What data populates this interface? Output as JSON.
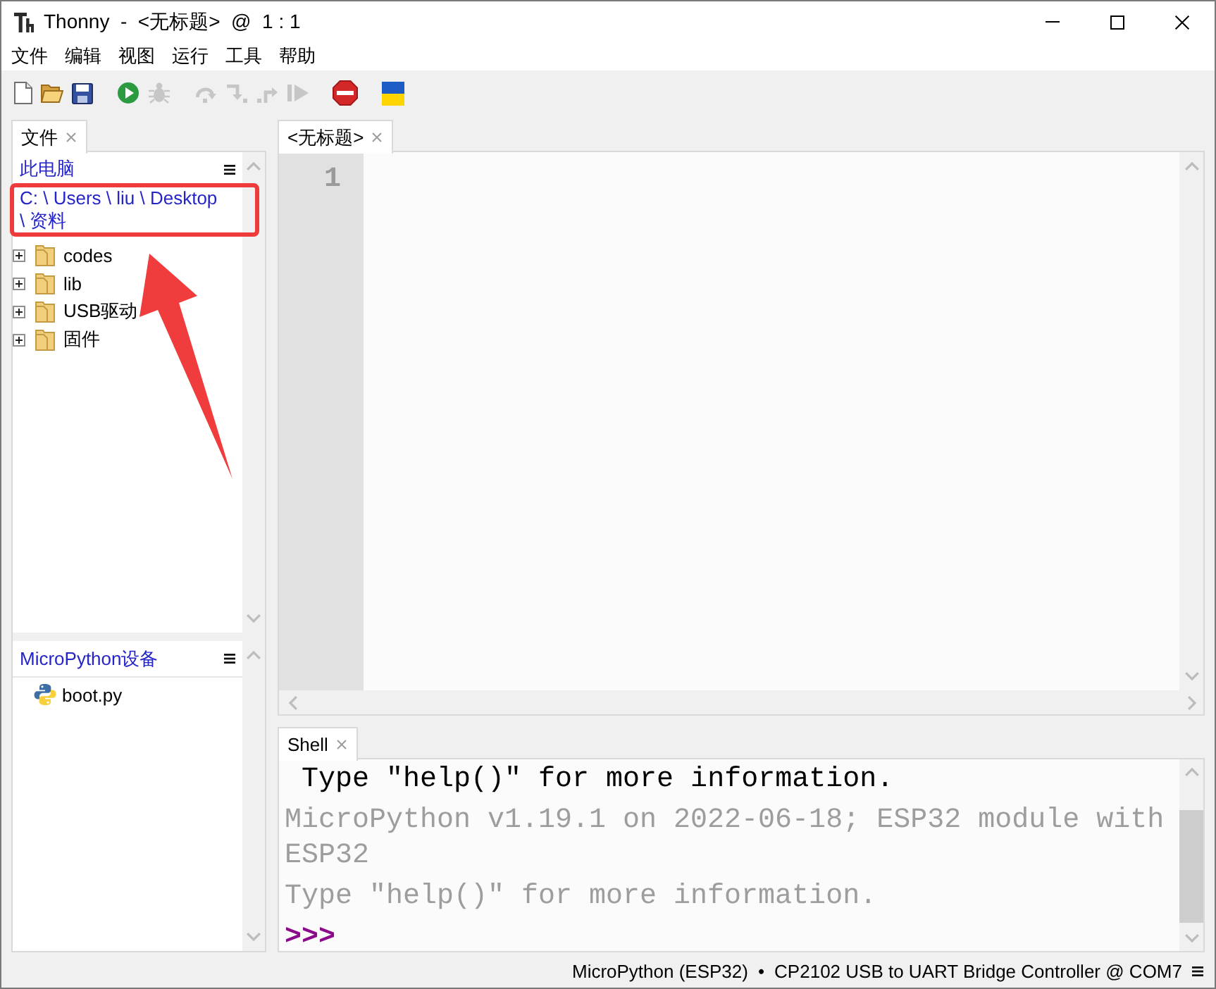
{
  "window": {
    "title": "Thonny  -  <无标题>  @  1 : 1"
  },
  "menu": [
    "文件",
    "编辑",
    "视图",
    "运行",
    "工具",
    "帮助"
  ],
  "toolbar": [
    {
      "kind": "new",
      "disabled": false
    },
    {
      "kind": "open",
      "disabled": false
    },
    {
      "kind": "save",
      "disabled": false
    },
    {
      "kind": "run",
      "disabled": false
    },
    {
      "kind": "debug",
      "disabled": true
    },
    {
      "kind": "step-over",
      "disabled": true
    },
    {
      "kind": "step-into",
      "disabled": true
    },
    {
      "kind": "step-out",
      "disabled": true
    },
    {
      "kind": "resume",
      "disabled": true
    },
    {
      "kind": "stop",
      "disabled": false
    },
    {
      "kind": "flag",
      "disabled": false
    }
  ],
  "files_panel": {
    "tab": {
      "label": "文件",
      "selected": true
    },
    "header": "此电脑",
    "path": {
      "text": "C: \\ Users \\ liu \\ Desktop \\ 资料",
      "highlighted": true
    },
    "tree": [
      {
        "name": "codes",
        "expanded": false
      },
      {
        "name": "lib",
        "expanded": false
      },
      {
        "name": "USB驱动",
        "expanded": false
      },
      {
        "name": "固件",
        "expanded": false
      }
    ]
  },
  "device_panel": {
    "header": "MicroPython设备",
    "files": [
      {
        "name": "boot.py"
      }
    ]
  },
  "editor": {
    "tab": {
      "label": "<无标题>",
      "selected": true
    },
    "line_numbers": [
      "1"
    ]
  },
  "shell": {
    "tab": {
      "label": "Shell",
      "selected": true
    },
    "lines": [
      {
        "kind": "output",
        "text": " Type \"help()\" for more information."
      },
      {
        "kind": "banner",
        "text": "MicroPython v1.19.1 on 2022-06-18; ESP32 module with ESP32"
      },
      {
        "kind": "banner",
        "text": "Type \"help()\" for more information."
      },
      {
        "kind": "prompt",
        "text": ">>>"
      }
    ]
  },
  "status_bar": {
    "interpreter": "MicroPython (ESP32)",
    "separator": "•",
    "port": "CP2102 USB to UART Bridge Controller @ COM7"
  },
  "annotations": [
    {
      "kind": "arrow"
    }
  ]
}
